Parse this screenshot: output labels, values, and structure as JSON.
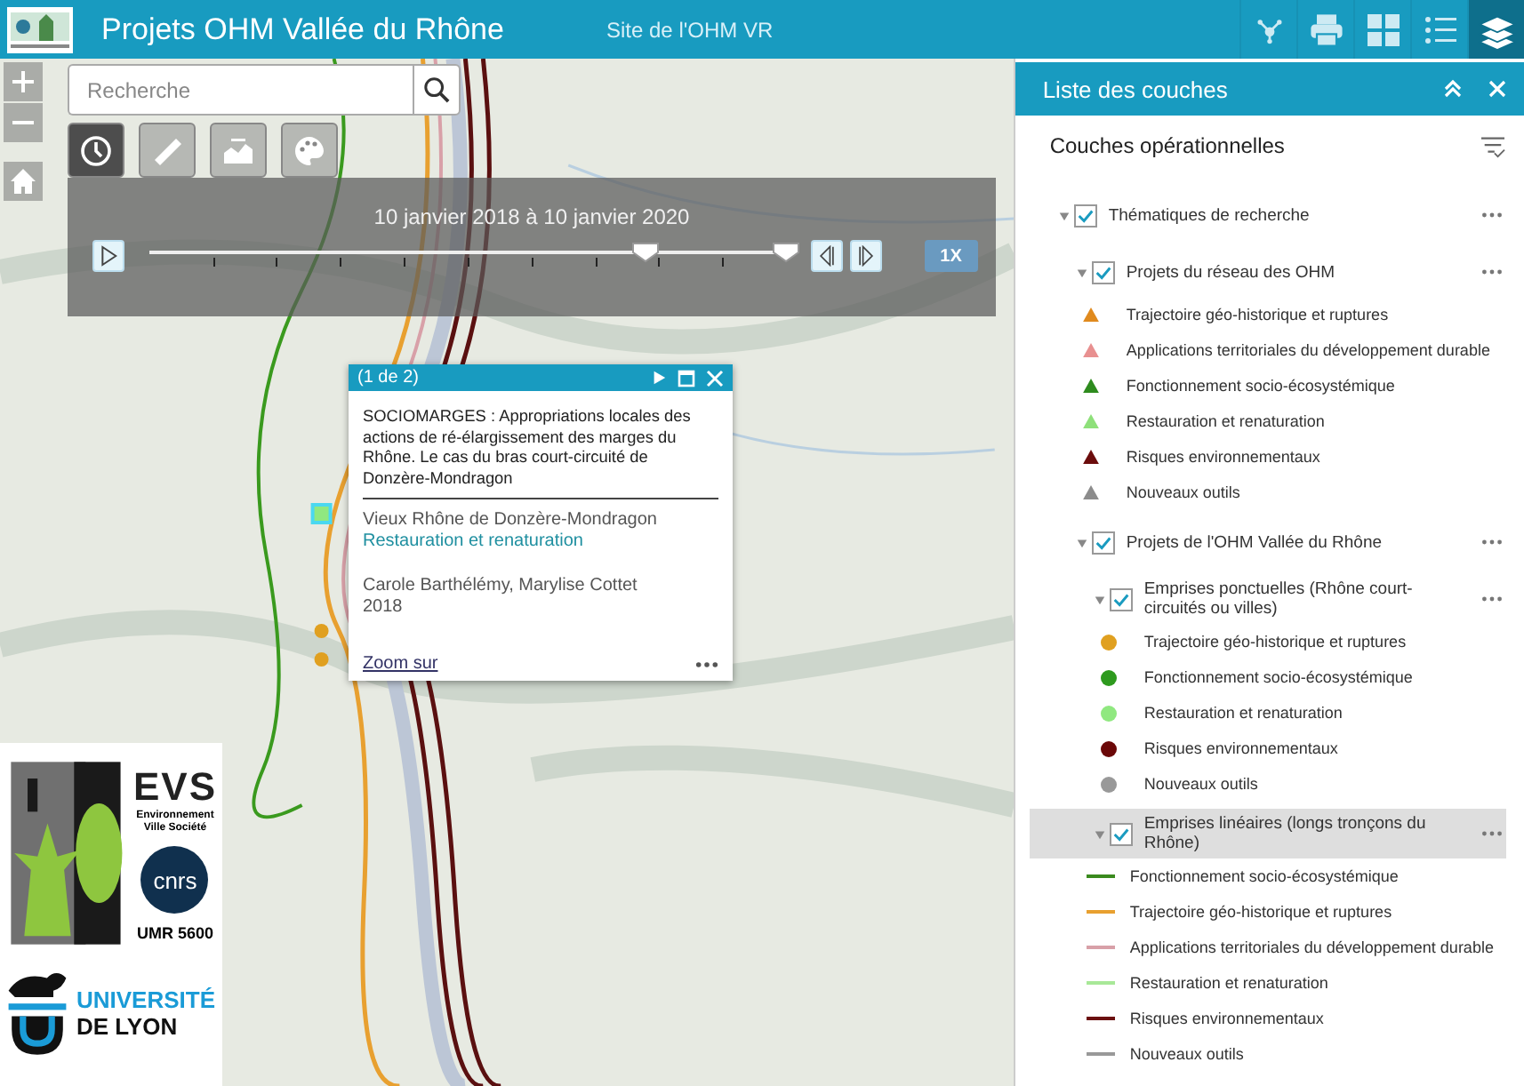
{
  "header": {
    "title": "Projets OHM Vallée du Rhône",
    "link": "Site de l'OHM VR",
    "tools": [
      {
        "kind": "share",
        "selected": false
      },
      {
        "kind": "print",
        "selected": false
      },
      {
        "kind": "grid",
        "selected": false
      },
      {
        "kind": "list",
        "selected": false
      },
      {
        "kind": "layers",
        "selected": true
      }
    ]
  },
  "search": {
    "placeholder": "Recherche"
  },
  "map_tools": [
    {
      "kind": "time",
      "selected": true
    },
    {
      "kind": "measure",
      "selected": false
    },
    {
      "kind": "profile",
      "selected": false
    },
    {
      "kind": "palette",
      "selected": false
    }
  ],
  "time_slider": {
    "label": "10 janvier 2018 à 10 janvier 2020",
    "speed": "1X",
    "thumbs": [
      {
        "level": 0.78
      },
      {
        "level": 1
      }
    ]
  },
  "popup": {
    "counter": "(1 de 2)",
    "title": "SOCIOMARGES : Appropriations locales des actions de ré-élargissement des marges du Rhône. Le cas du bras court-circuité de Donzère-Mondragon",
    "place": "Vieux Rhône de Donzère-Mondragon",
    "theme": "Restauration et renaturation",
    "authors": "Carole Barthélémy, Marylise Cottet",
    "year": "2018",
    "zoom": "Zoom sur"
  },
  "logos": {
    "evs": "EVS",
    "evs_sub": "Environnement Ville Société",
    "cnrs": "cnrs",
    "umr": "UMR 5600",
    "univ_1": "UNIVERSITÉ",
    "univ_2": "DE LYON"
  },
  "layers": {
    "title": "Liste des couches",
    "heading": "Couches opérationnelles",
    "tree": [
      {
        "kind": "layer",
        "label": "Thématiques de recherche",
        "checked": true,
        "expanded": true,
        "selected": false,
        "children": [
          {
            "kind": "layer",
            "label": "Projets du réseau des OHM",
            "checked": true,
            "expanded": true,
            "selected": false,
            "children": [
              {
                "kind": "triangle",
                "label": "Trajectoire géo-historique et ruptures",
                "color": "#e08a1e"
              },
              {
                "kind": "triangle",
                "label": "Applications territoriales du développement durable",
                "color": "#e89090"
              },
              {
                "kind": "triangle",
                "label": "Fonctionnement socio-écosystémique",
                "color": "#2e8b1e"
              },
              {
                "kind": "triangle",
                "label": "Restauration et renaturation",
                "color": "#8ee07a"
              },
              {
                "kind": "triangle",
                "label": "Risques environnementaux",
                "color": "#6b0c0c"
              },
              {
                "kind": "triangle",
                "label": "Nouveaux outils",
                "color": "#8c8c8c"
              }
            ]
          },
          {
            "kind": "layer",
            "label": "Projets de l'OHM Vallée du Rhône",
            "checked": true,
            "expanded": true,
            "selected": false,
            "children": [
              {
                "kind": "layer",
                "label": "Emprises ponctuelles (Rhône court-circuités ou villes)",
                "checked": true,
                "expanded": true,
                "selected": false,
                "children": [
                  {
                    "kind": "dot",
                    "label": "Trajectoire géo-historique et ruptures",
                    "color": "#e0a020"
                  },
                  {
                    "kind": "dot",
                    "label": "Fonctionnement socio-écosystémique",
                    "color": "#2e9a1e"
                  },
                  {
                    "kind": "dot",
                    "label": "Restauration et renaturation",
                    "color": "#90e880"
                  },
                  {
                    "kind": "dot",
                    "label": "Risques environnementaux",
                    "color": "#6b0808"
                  },
                  {
                    "kind": "dot",
                    "label": "Nouveaux outils",
                    "color": "#999999"
                  }
                ]
              },
              {
                "kind": "layer",
                "label": "Emprises linéaires (longs tronçons du Rhône)",
                "checked": true,
                "expanded": true,
                "selected": true,
                "children": [
                  {
                    "kind": "line",
                    "label": "Fonctionnement socio-écosystémique",
                    "color": "#3a8a1e"
                  },
                  {
                    "kind": "line",
                    "label": "Trajectoire géo-historique et ruptures",
                    "color": "#e8a030"
                  },
                  {
                    "kind": "line",
                    "label": "Applications territoriales du développement durable",
                    "color": "#d8a0a8"
                  },
                  {
                    "kind": "line",
                    "label": "Restauration et renaturation",
                    "color": "#a8e898"
                  },
                  {
                    "kind": "line",
                    "label": "Risques environnementaux",
                    "color": "#6b1010"
                  },
                  {
                    "kind": "line",
                    "label": "Nouveaux outils",
                    "color": "#999999"
                  }
                ]
              }
            ]
          }
        ]
      }
    ]
  }
}
